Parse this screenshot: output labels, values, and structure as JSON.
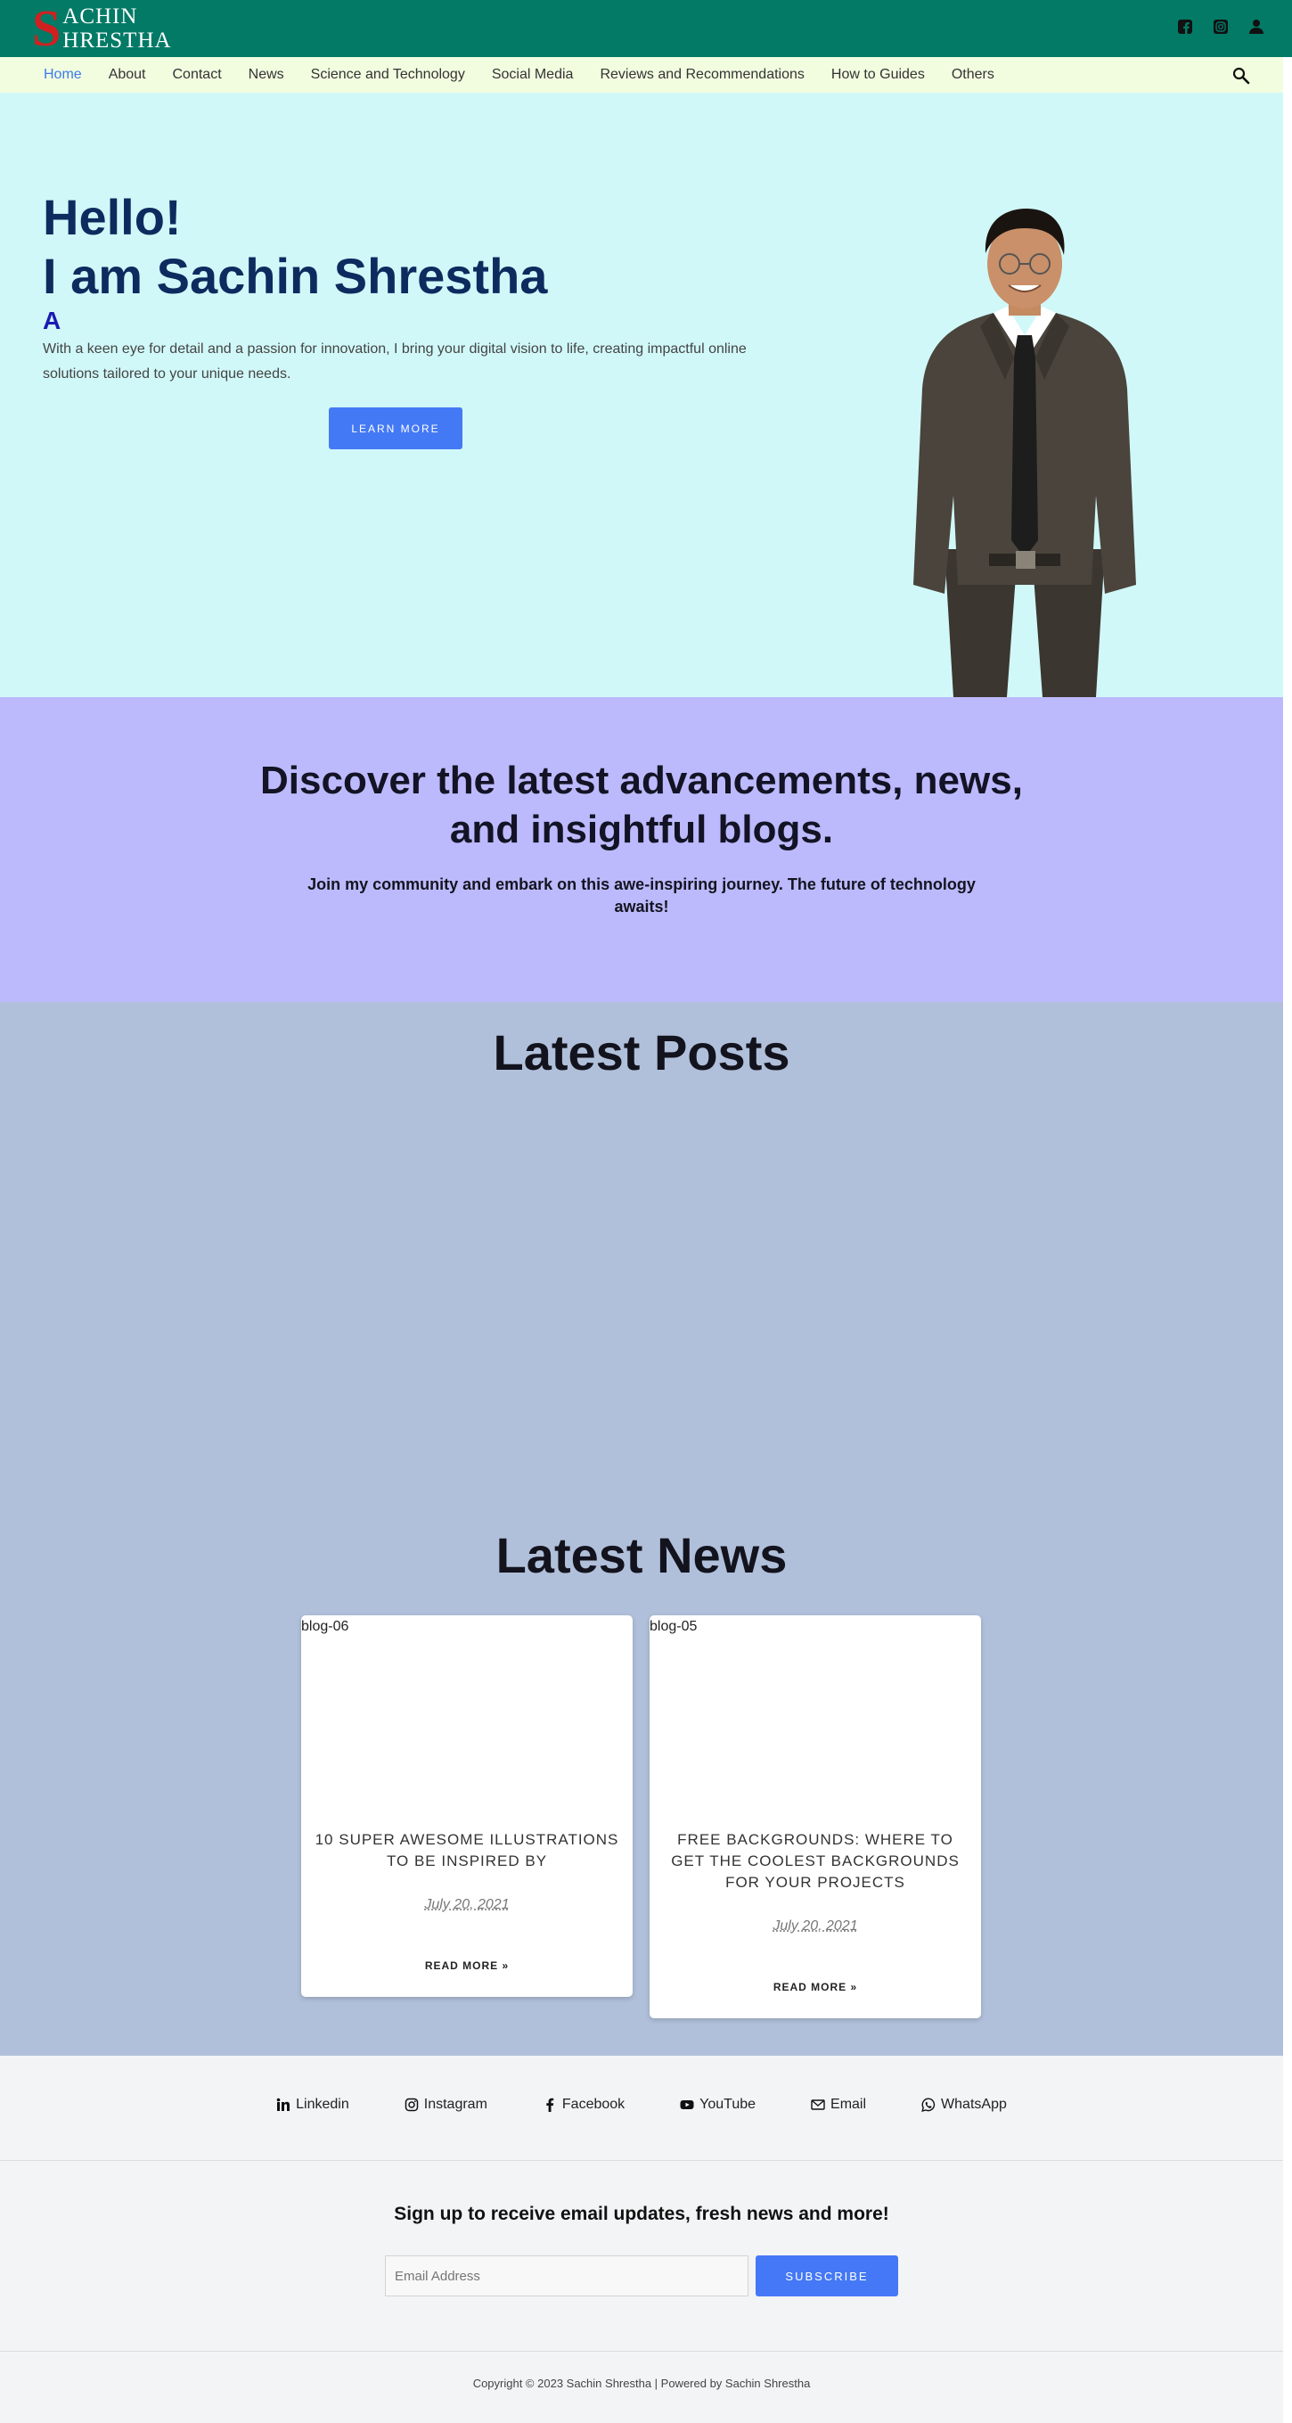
{
  "header": {
    "logo_initial": "S",
    "logo_line1": "ACHIN",
    "logo_line2": "HRESTHA"
  },
  "icons": {
    "top": [
      "facebook-icon",
      "instagram-icon",
      "user-icon"
    ],
    "nav_search": "search-icon"
  },
  "nav": {
    "items": [
      "Home",
      "About",
      "Contact",
      "News",
      "Science and Technology",
      "Social Media",
      "Reviews and Recommendations",
      "How to Guides",
      "Others"
    ],
    "active": "Home"
  },
  "hero": {
    "line1": "Hello!",
    "line2": "I am Sachin Shrestha",
    "typed": "A",
    "description": "With a keen eye for detail and a passion for innovation, I bring your digital vision to life, creating impactful online solutions tailored to your unique needs.",
    "button": "Learn More"
  },
  "discover": {
    "heading": "Discover the latest advancements, news, and insightful blogs.",
    "subheading": "Join my community and embark on this awe-inspiring journey. The future of technology awaits!"
  },
  "latest_posts": {
    "title": "Latest Posts"
  },
  "latest_news": {
    "title": "Latest News",
    "cards": [
      {
        "image_alt": "blog-06",
        "title": "10 Super Awesome Illustrations to Be Inspired By",
        "date": "July 20, 2021",
        "more": "Read More »"
      },
      {
        "image_alt": "blog-05",
        "title": "Free Backgrounds: Where to Get the Coolest Backgrounds for Your Projects",
        "date": "July 20, 2021",
        "more": "Read More »"
      }
    ]
  },
  "footer": {
    "social": [
      {
        "label": "Linkedin",
        "icon": "linkedin-icon"
      },
      {
        "label": "Instagram",
        "icon": "instagram-icon"
      },
      {
        "label": "Facebook",
        "icon": "facebook-icon"
      },
      {
        "label": "YouTube",
        "icon": "youtube-icon"
      },
      {
        "label": "Email",
        "icon": "email-icon"
      },
      {
        "label": "WhatsApp",
        "icon": "whatsapp-icon"
      }
    ],
    "newsletter_heading": "Sign up to receive email updates, fresh news and more!",
    "email_placeholder": "Email Address",
    "subscribe": "Subscribe",
    "copyright": "Copyright © 2023 Sachin Shrestha | Powered by Sachin Shrestha"
  },
  "colors": {
    "header_bg": "#037a66",
    "nav_bg": "#f2fde0",
    "hero_bg": "#d1f8f8",
    "discover_bg": "#bcbafc",
    "posts_bg": "#b1c0da",
    "accent": "#4479f5",
    "heading_navy": "#0d2b5e"
  }
}
